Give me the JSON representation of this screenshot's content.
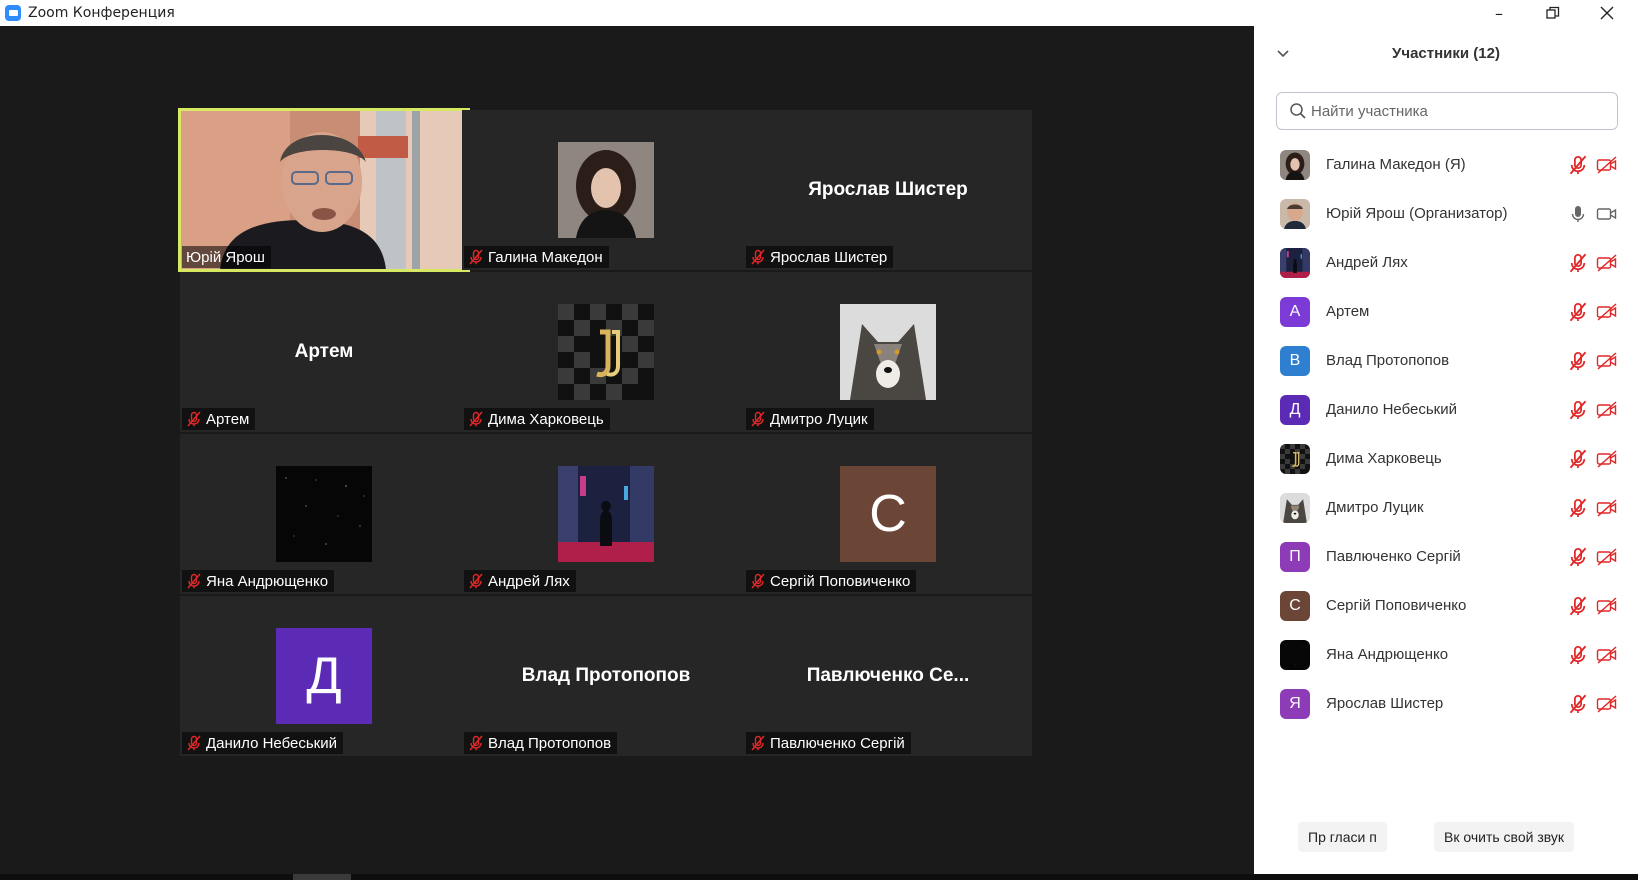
{
  "window": {
    "title": "Zoom Конференция",
    "controls": {
      "minimize": "–",
      "restore": "❐",
      "close": "✕"
    }
  },
  "gallery": {
    "tiles": [
      {
        "name": "Юрій Ярош",
        "kind": "video",
        "active": true
      },
      {
        "name": "Галина Македон",
        "kind": "photo",
        "photo": "woman-portrait"
      },
      {
        "name": "Ярослав Шистер",
        "kind": "text",
        "center": "Ярослав Шистер"
      },
      {
        "name": "Артем",
        "kind": "text",
        "center": "Артем"
      },
      {
        "name": "Дима Харковець",
        "kind": "photo",
        "photo": "juventus-logo"
      },
      {
        "name": "Дмитро Луцик",
        "kind": "photo",
        "photo": "wolf"
      },
      {
        "name": "Яна Андрющенко",
        "kind": "photo",
        "photo": "night-sky"
      },
      {
        "name": "Андрей Лях",
        "kind": "photo",
        "photo": "neon-city"
      },
      {
        "name": "Сергій Поповиченко",
        "kind": "letter",
        "letter": "С",
        "color": "#6b4636"
      },
      {
        "name": "Данило Небеський",
        "kind": "letter",
        "letter": "Д",
        "color": "#5b2bb5"
      },
      {
        "name": "Влад Протопопов",
        "kind": "text",
        "center": "Влад Протопопов"
      },
      {
        "name": "Павлюченко Сергій",
        "kind": "text",
        "center": "Павлюченко  Се..."
      }
    ]
  },
  "sidebar": {
    "title": "Участники (12)",
    "search_placeholder": "Найти участника",
    "participants": [
      {
        "name": "Галина Македон (Я)",
        "avatar": "photo-woman",
        "mic": "muted",
        "cam": "off"
      },
      {
        "name": "Юрій Ярош (Организатор)",
        "avatar": "photo-man",
        "mic": "on",
        "cam": "on"
      },
      {
        "name": "Андрей Лях",
        "avatar": "photo-neon",
        "mic": "muted",
        "cam": "off"
      },
      {
        "name": "Артем",
        "avatar": "letter",
        "letter": "A",
        "color": "#7c3bd6",
        "mic": "muted",
        "cam": "off"
      },
      {
        "name": "Влад Протопопов",
        "avatar": "letter",
        "letter": "B",
        "color": "#2f7fd1",
        "mic": "muted",
        "cam": "off"
      },
      {
        "name": "Данило Небеський",
        "avatar": "letter",
        "letter": "Д",
        "color": "#5b2bb5",
        "mic": "muted",
        "cam": "off"
      },
      {
        "name": "Дима Харковець",
        "avatar": "photo-juve",
        "mic": "muted",
        "cam": "off"
      },
      {
        "name": "Дмитро Луцик",
        "avatar": "photo-wolf",
        "mic": "muted",
        "cam": "off"
      },
      {
        "name": "Павлюченко Сергій",
        "avatar": "letter",
        "letter": "П",
        "color": "#8e3bb8",
        "mic": "muted",
        "cam": "off"
      },
      {
        "name": "Сергій Поповиченко",
        "avatar": "letter",
        "letter": "С",
        "color": "#6b4636",
        "mic": "muted",
        "cam": "off"
      },
      {
        "name": "Яна Андрющенко",
        "avatar": "photo-night",
        "mic": "muted",
        "cam": "off"
      },
      {
        "name": "Ярослав Шистер",
        "avatar": "letter",
        "letter": "Я",
        "color": "#8e3bb8",
        "mic": "muted",
        "cam": "off"
      }
    ],
    "footer": {
      "invite": "Пр  гласи  п",
      "unmute": "Вк  очить свой звук"
    }
  },
  "colors": {
    "muted": "#e02828",
    "active_border": "#d7e862",
    "sidebar_bg": "#ffffff",
    "gallery_bg": "#1a1a1a"
  }
}
